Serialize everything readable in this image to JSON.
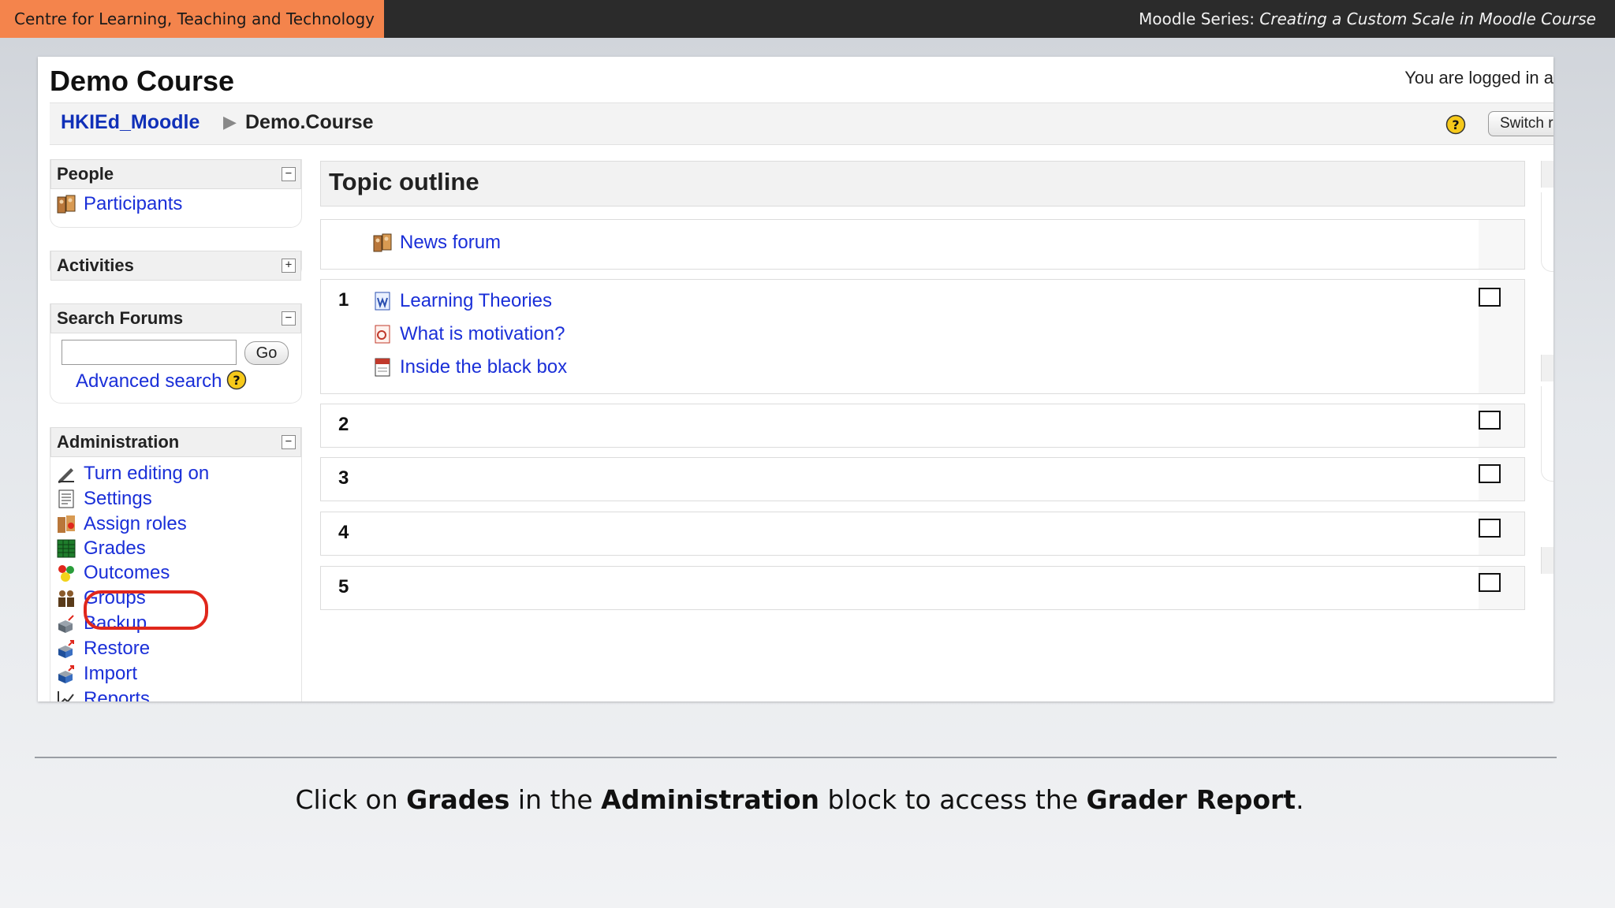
{
  "banner": {
    "organization": "Centre for Learning, Teaching and Technology",
    "series_prefix": "Moodle Series:",
    "series_title": "Creating a Custom Scale in Moodle Course"
  },
  "header": {
    "course_title": "Demo Course",
    "logged_in_text": "You are logged in a",
    "breadcrumb_home": "HKIEd_Moodle",
    "breadcrumb_current": "Demo.Course",
    "switch_role_label": "Switch ro"
  },
  "blocks": {
    "people": {
      "title": "People",
      "toggle": "−",
      "items": [
        "Participants"
      ]
    },
    "activities": {
      "title": "Activities",
      "toggle": "+"
    },
    "search": {
      "title": "Search Forums",
      "toggle": "−",
      "input_value": "",
      "go_label": "Go",
      "advanced_label": "Advanced search"
    },
    "administration": {
      "title": "Administration",
      "toggle": "−",
      "items": [
        "Turn editing on",
        "Settings",
        "Assign roles",
        "Grades",
        "Outcomes",
        "Groups",
        "Backup",
        "Restore",
        "Import",
        "Reports"
      ]
    }
  },
  "main": {
    "heading": "Topic outline",
    "news": "News forum",
    "sections": [
      {
        "number": "1",
        "items": [
          "Learning Theories",
          "What is motivation?",
          "Inside the black box"
        ]
      },
      {
        "number": "2",
        "items": []
      },
      {
        "number": "3",
        "items": []
      },
      {
        "number": "4",
        "items": []
      },
      {
        "number": "5",
        "items": []
      }
    ]
  },
  "caption": {
    "part1": "Click on ",
    "bold1": "Grades",
    "part2": " in the ",
    "bold2": "Administration",
    "part3": " block to access the ",
    "bold3": "Grader Report",
    "part4": "."
  },
  "colors": {
    "accent": "#f4844c",
    "link": "#1a2fd8",
    "highlight": "#e0271c"
  }
}
